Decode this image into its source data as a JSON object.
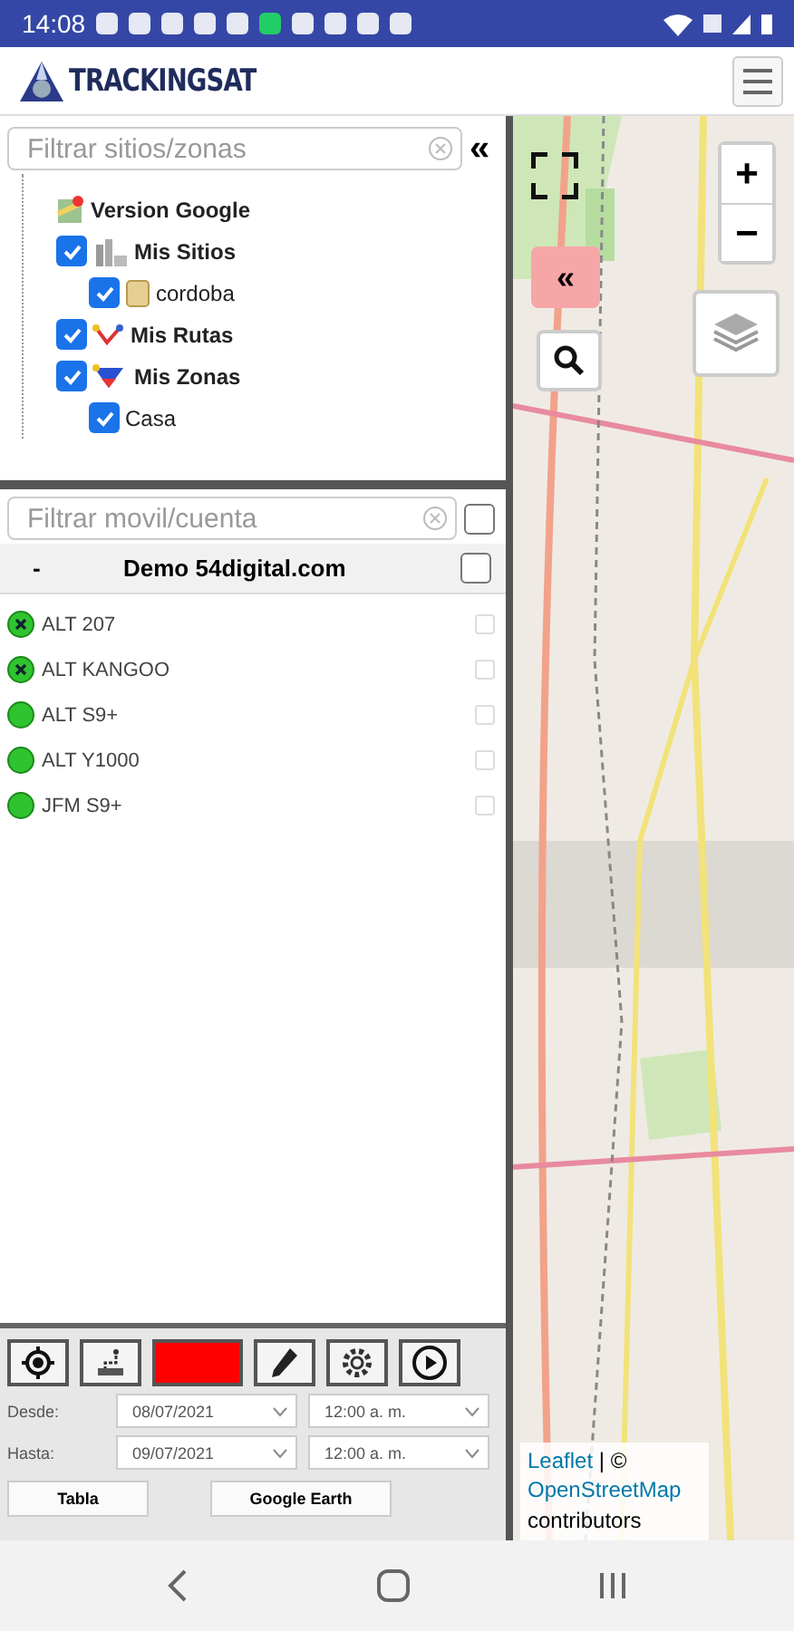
{
  "status_bar": {
    "time": "14:08"
  },
  "header": {
    "logo_text": "TRACKINGSAT"
  },
  "sites_panel": {
    "filter": {
      "placeholder": "Filtrar sitios/zonas"
    },
    "collapse": "«",
    "tree": [
      {
        "label": "Version Google",
        "kind": "map",
        "bold": true
      },
      {
        "label": "Mis Sitios",
        "kind": "sites",
        "bold": true,
        "checked": true,
        "children": [
          {
            "label": "cordoba",
            "kind": "folder",
            "bold": false,
            "checked": true
          }
        ]
      },
      {
        "label": "Mis Rutas",
        "kind": "routes",
        "bold": true,
        "checked": true
      },
      {
        "label": "Mis Zonas",
        "kind": "zones",
        "bold": true,
        "checked": true,
        "children": [
          {
            "label": "Casa",
            "kind": "none",
            "bold": false,
            "checked": true
          }
        ]
      }
    ]
  },
  "vehicles_panel": {
    "filter": {
      "placeholder": "Filtrar movil/cuenta"
    },
    "select_all": {
      "checked": false
    },
    "account": {
      "toggle": "-",
      "name": "Demo 54digital.com",
      "checked": false
    },
    "vehicles": [
      {
        "name": "ALT 207",
        "kind": "crossed",
        "checked": false
      },
      {
        "name": "ALT KANGOO",
        "kind": "crossed",
        "checked": false
      },
      {
        "name": "ALT S9+",
        "kind": "plain",
        "checked": false
      },
      {
        "name": "ALT Y1000",
        "kind": "plain",
        "checked": false
      },
      {
        "name": "JFM S9+",
        "kind": "plain",
        "checked": false
      }
    ]
  },
  "controls": {
    "color": "#ff0000",
    "desde": {
      "label": "Desde:",
      "date": "08/07/2021",
      "time": "12:00 a. m."
    },
    "hasta": {
      "label": "Hasta:",
      "date": "09/07/2021",
      "time": "12:00 a. m."
    },
    "buttons": [
      "Tabla",
      "Google Earth"
    ]
  },
  "map": {
    "zoom_in": "+",
    "zoom_out": "−",
    "expand": "«",
    "attribution": {
      "link1": "Leaflet",
      "sep": " | © ",
      "link2": "OpenStreetMap",
      "rest": "contributors"
    }
  }
}
